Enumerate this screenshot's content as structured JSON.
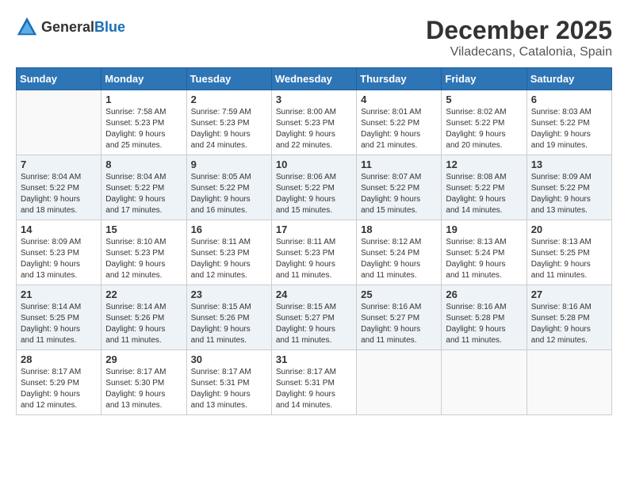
{
  "logo": {
    "text_general": "General",
    "text_blue": "Blue"
  },
  "header": {
    "month": "December 2025",
    "location": "Viladecans, Catalonia, Spain"
  },
  "weekdays": [
    "Sunday",
    "Monday",
    "Tuesday",
    "Wednesday",
    "Thursday",
    "Friday",
    "Saturday"
  ],
  "weeks": [
    [
      {
        "day": "",
        "info": ""
      },
      {
        "day": "1",
        "info": "Sunrise: 7:58 AM\nSunset: 5:23 PM\nDaylight: 9 hours\nand 25 minutes."
      },
      {
        "day": "2",
        "info": "Sunrise: 7:59 AM\nSunset: 5:23 PM\nDaylight: 9 hours\nand 24 minutes."
      },
      {
        "day": "3",
        "info": "Sunrise: 8:00 AM\nSunset: 5:23 PM\nDaylight: 9 hours\nand 22 minutes."
      },
      {
        "day": "4",
        "info": "Sunrise: 8:01 AM\nSunset: 5:22 PM\nDaylight: 9 hours\nand 21 minutes."
      },
      {
        "day": "5",
        "info": "Sunrise: 8:02 AM\nSunset: 5:22 PM\nDaylight: 9 hours\nand 20 minutes."
      },
      {
        "day": "6",
        "info": "Sunrise: 8:03 AM\nSunset: 5:22 PM\nDaylight: 9 hours\nand 19 minutes."
      }
    ],
    [
      {
        "day": "7",
        "info": "Sunrise: 8:04 AM\nSunset: 5:22 PM\nDaylight: 9 hours\nand 18 minutes."
      },
      {
        "day": "8",
        "info": "Sunrise: 8:04 AM\nSunset: 5:22 PM\nDaylight: 9 hours\nand 17 minutes."
      },
      {
        "day": "9",
        "info": "Sunrise: 8:05 AM\nSunset: 5:22 PM\nDaylight: 9 hours\nand 16 minutes."
      },
      {
        "day": "10",
        "info": "Sunrise: 8:06 AM\nSunset: 5:22 PM\nDaylight: 9 hours\nand 15 minutes."
      },
      {
        "day": "11",
        "info": "Sunrise: 8:07 AM\nSunset: 5:22 PM\nDaylight: 9 hours\nand 15 minutes."
      },
      {
        "day": "12",
        "info": "Sunrise: 8:08 AM\nSunset: 5:22 PM\nDaylight: 9 hours\nand 14 minutes."
      },
      {
        "day": "13",
        "info": "Sunrise: 8:09 AM\nSunset: 5:22 PM\nDaylight: 9 hours\nand 13 minutes."
      }
    ],
    [
      {
        "day": "14",
        "info": "Sunrise: 8:09 AM\nSunset: 5:23 PM\nDaylight: 9 hours\nand 13 minutes."
      },
      {
        "day": "15",
        "info": "Sunrise: 8:10 AM\nSunset: 5:23 PM\nDaylight: 9 hours\nand 12 minutes."
      },
      {
        "day": "16",
        "info": "Sunrise: 8:11 AM\nSunset: 5:23 PM\nDaylight: 9 hours\nand 12 minutes."
      },
      {
        "day": "17",
        "info": "Sunrise: 8:11 AM\nSunset: 5:23 PM\nDaylight: 9 hours\nand 11 minutes."
      },
      {
        "day": "18",
        "info": "Sunrise: 8:12 AM\nSunset: 5:24 PM\nDaylight: 9 hours\nand 11 minutes."
      },
      {
        "day": "19",
        "info": "Sunrise: 8:13 AM\nSunset: 5:24 PM\nDaylight: 9 hours\nand 11 minutes."
      },
      {
        "day": "20",
        "info": "Sunrise: 8:13 AM\nSunset: 5:25 PM\nDaylight: 9 hours\nand 11 minutes."
      }
    ],
    [
      {
        "day": "21",
        "info": "Sunrise: 8:14 AM\nSunset: 5:25 PM\nDaylight: 9 hours\nand 11 minutes."
      },
      {
        "day": "22",
        "info": "Sunrise: 8:14 AM\nSunset: 5:26 PM\nDaylight: 9 hours\nand 11 minutes."
      },
      {
        "day": "23",
        "info": "Sunrise: 8:15 AM\nSunset: 5:26 PM\nDaylight: 9 hours\nand 11 minutes."
      },
      {
        "day": "24",
        "info": "Sunrise: 8:15 AM\nSunset: 5:27 PM\nDaylight: 9 hours\nand 11 minutes."
      },
      {
        "day": "25",
        "info": "Sunrise: 8:16 AM\nSunset: 5:27 PM\nDaylight: 9 hours\nand 11 minutes."
      },
      {
        "day": "26",
        "info": "Sunrise: 8:16 AM\nSunset: 5:28 PM\nDaylight: 9 hours\nand 11 minutes."
      },
      {
        "day": "27",
        "info": "Sunrise: 8:16 AM\nSunset: 5:28 PM\nDaylight: 9 hours\nand 12 minutes."
      }
    ],
    [
      {
        "day": "28",
        "info": "Sunrise: 8:17 AM\nSunset: 5:29 PM\nDaylight: 9 hours\nand 12 minutes."
      },
      {
        "day": "29",
        "info": "Sunrise: 8:17 AM\nSunset: 5:30 PM\nDaylight: 9 hours\nand 13 minutes."
      },
      {
        "day": "30",
        "info": "Sunrise: 8:17 AM\nSunset: 5:31 PM\nDaylight: 9 hours\nand 13 minutes."
      },
      {
        "day": "31",
        "info": "Sunrise: 8:17 AM\nSunset: 5:31 PM\nDaylight: 9 hours\nand 14 minutes."
      },
      {
        "day": "",
        "info": ""
      },
      {
        "day": "",
        "info": ""
      },
      {
        "day": "",
        "info": ""
      }
    ]
  ]
}
